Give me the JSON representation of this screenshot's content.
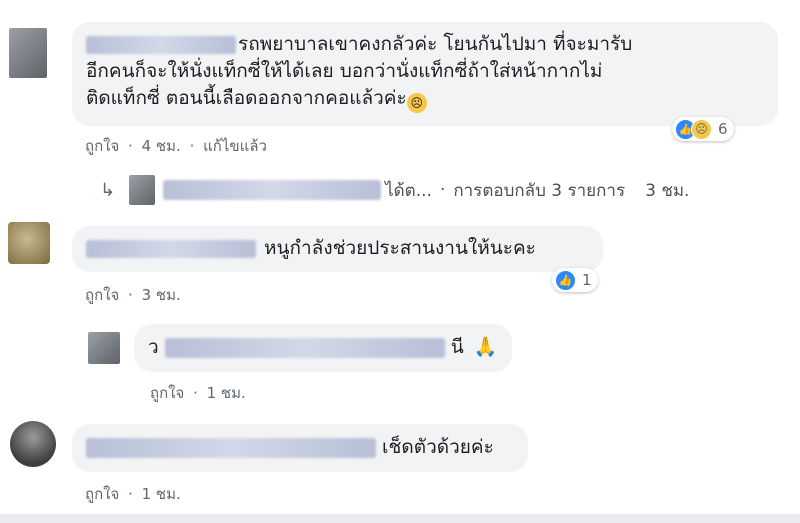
{
  "comments": [
    {
      "text": "รถพยาบาลเขาคงกลัวค่ะ โยนกันไปมา ที่จะมารับ",
      "text2": "อีกคนก็จะให้นั่งแท็กซี่ให้ได้เลย บอกว่านั่งแท็กซี่ถ้าใส่หน้ากากไม่",
      "text3": "ติดแท็กซี่ ตอนนี้เลือดออกจากคอแล้วค่ะ",
      "like": "ถูกใจ",
      "time": "4 ชม.",
      "edited": "แก้ไขแล้ว",
      "reaction_count": "6"
    },
    {
      "text": "หนูกำลังช่วยประสานงานให้นะคะ",
      "like": "ถูกใจ",
      "time": "3 ชม.",
      "reaction_count": "1"
    },
    {
      "text": "เช็ดตัวด้วยค่ะ",
      "like": "ถูกใจ",
      "time": "1 ชม."
    }
  ],
  "reply_summary": {
    "suffix": "ได้ต...",
    "replies": "การตอบกลับ 3 รายการ",
    "time": "3 ชม."
  },
  "nested_reply": {
    "prefix": "ว",
    "suffix": "นี",
    "emoji": "🙏",
    "like": "ถูกใจ",
    "time": "1 ชม."
  },
  "meta_separator": "·",
  "icons": [
    "like-icon",
    "sad-icon",
    "reply-arrow-icon",
    "pray-emoji",
    "sad-emoji"
  ]
}
